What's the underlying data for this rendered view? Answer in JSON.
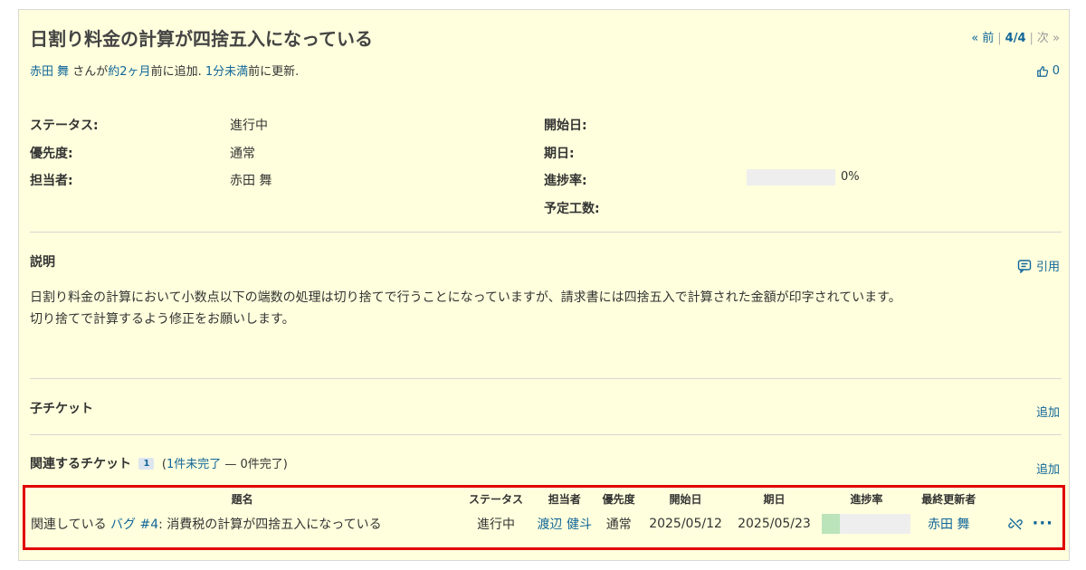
{
  "issue": {
    "title": "日割り料金の計算が四捨五入になっている",
    "nav": {
      "prev": "« 前",
      "position": "4/4",
      "next": "次 »"
    },
    "author": {
      "name": "赤田 舞",
      "text1": " さんが",
      "added_ago": "約2ヶ月",
      "text2": "前に追加. ",
      "updated_ago": "1分未満",
      "text3": "前に更新."
    },
    "votes": "0",
    "attributes": {
      "status_label": "ステータス:",
      "status": "進行中",
      "priority_label": "優先度:",
      "priority": "通常",
      "assignee_label": "担当者:",
      "assignee": "赤田 舞",
      "start_date_label": "開始日:",
      "due_date_label": "期日:",
      "progress_label": "進捗率:",
      "progress_text": "0%",
      "progress_value": 0,
      "estimated_label": "予定工数:"
    },
    "description": {
      "heading": "説明",
      "quote_label": "引用",
      "line1": "日割り料金の計算において小数点以下の端数の処理は切り捨てで行うことになっていますが、請求書には四捨五入で計算された金額が印字されています。",
      "line2": "切り捨てで計算するよう修正をお願いします。"
    },
    "subtasks": {
      "heading": "子チケット",
      "add_label": "追加"
    },
    "relations": {
      "heading": "関連するチケット",
      "count": "1",
      "open_text": "1件未完了",
      "closed_text": " — 0件完了)",
      "add_label": "追加",
      "columns": [
        "題名",
        "ステータス",
        "担当者",
        "優先度",
        "開始日",
        "期日",
        "進捗率",
        "最終更新者"
      ],
      "rows": [
        {
          "relation": "関連している",
          "tracker_link": "バグ #4",
          "subject": ": 消費税の計算が四捨五入になっている",
          "status": "進行中",
          "assignee": "渡辺 健斗",
          "priority": "通常",
          "start_date": "2025/05/12",
          "due_date": "2025/05/23",
          "progress_value": 20,
          "last_updated_by": "赤田 舞"
        }
      ]
    }
  },
  "colors": {
    "background": "#ffffdd",
    "link": "#116699",
    "highlight_border": "#e00000",
    "progress_done": "#bbe4bb"
  }
}
